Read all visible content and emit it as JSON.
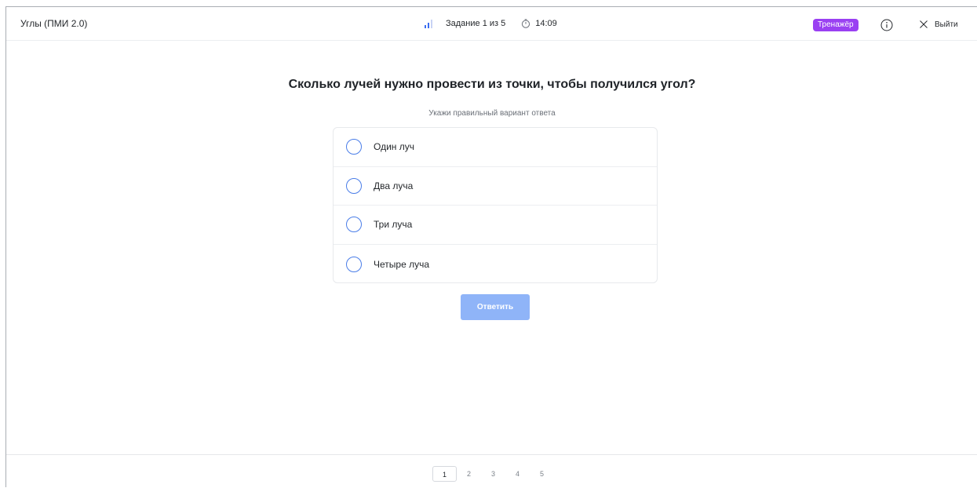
{
  "header": {
    "title": "Углы (ПМИ 2.0)",
    "task_progress": "Задание 1 из 5",
    "timer": "14:09",
    "mode_badge": "Тренажёр",
    "exit_label": "Выйти",
    "progress_icon": "bars-icon",
    "timer_icon": "stopwatch-icon",
    "info_icon": "info-icon",
    "close_icon": "close-icon"
  },
  "question": {
    "text": "Сколько лучей нужно провести из точки, чтобы получился угол?",
    "hint": "Укажи правильный вариант ответа",
    "options": [
      {
        "label": "Один луч",
        "selected": false
      },
      {
        "label": "Два луча",
        "selected": false
      },
      {
        "label": "Три луча",
        "selected": false
      },
      {
        "label": "Четыре луча",
        "selected": false
      }
    ],
    "submit_label": "Ответить"
  },
  "pagination": {
    "pages": [
      "1",
      "2",
      "3",
      "4",
      "5"
    ],
    "current": "1"
  },
  "colors": {
    "accent": "#3b6df1",
    "badge": "#9a40f2",
    "button_disabled": "#8fb4f8",
    "radio_border": "#4a7de8"
  }
}
